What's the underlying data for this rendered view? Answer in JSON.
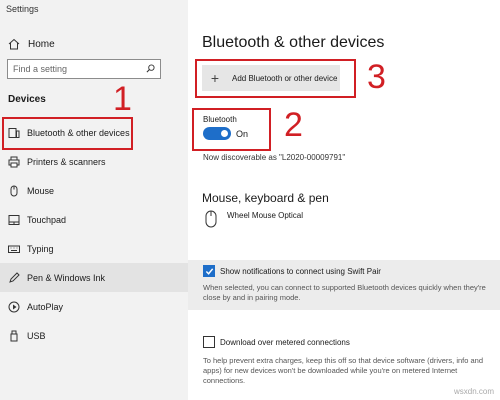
{
  "app": {
    "title": "Settings"
  },
  "sidebar": {
    "home_label": "Home",
    "search_placeholder": "Find a setting",
    "section_title": "Devices",
    "items": [
      {
        "label": "Bluetooth & other devices",
        "icon": "bluetooth-devices-icon"
      },
      {
        "label": "Printers & scanners",
        "icon": "printer-icon"
      },
      {
        "label": "Mouse",
        "icon": "mouse-icon"
      },
      {
        "label": "Touchpad",
        "icon": "touchpad-icon"
      },
      {
        "label": "Typing",
        "icon": "keyboard-icon"
      },
      {
        "label": "Pen & Windows Ink",
        "icon": "pen-icon"
      },
      {
        "label": "AutoPlay",
        "icon": "autoplay-icon"
      },
      {
        "label": "USB",
        "icon": "usb-icon"
      }
    ]
  },
  "main": {
    "title": "Bluetooth & other devices",
    "add_device_label": "Add Bluetooth or other device",
    "bluetooth": {
      "label": "Bluetooth",
      "state": "On",
      "discoverable": "Now discoverable as \"L2020-00009791\""
    },
    "mouse_section": {
      "title": "Mouse, keyboard & pen",
      "device": "Wheel Mouse Optical"
    },
    "swift_pair": {
      "label": "Show notifications to connect using Swift Pair",
      "checked": true,
      "description": "When selected, you can connect to supported Bluetooth devices quickly when they're close by and in pairing mode."
    },
    "metered": {
      "label": "Download over metered connections",
      "checked": false,
      "description": "To help prevent extra charges, keep this off so that device software (drivers, info and apps) for new devices won't be downloaded while you're on metered Internet connections."
    }
  },
  "annotations": {
    "one": "1",
    "two": "2",
    "three": "3",
    "color": "#d11f24"
  },
  "colors": {
    "accent": "#1e6ec9",
    "sidebar_bg": "#f2f2f2"
  },
  "watermark": "wsxdn.com"
}
